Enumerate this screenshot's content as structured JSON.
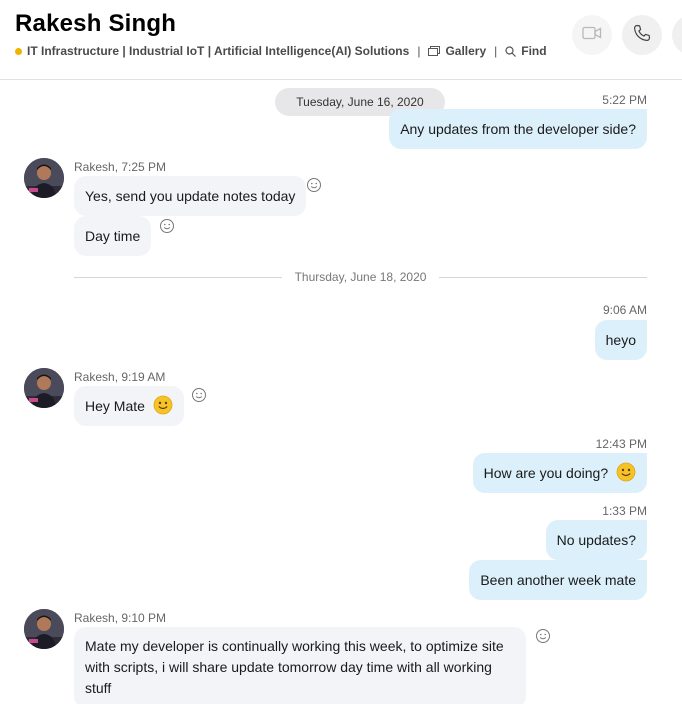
{
  "header": {
    "title": "Rakesh Singh",
    "status_color": "#f0b400",
    "mood": "IT Infrastructure | Industrial IoT | Artificial Intelligence(AI) Solutions",
    "separator": "|",
    "gallery_label": "Gallery",
    "find_label": "Find",
    "icons": [
      "video-call-icon",
      "phone-call-icon"
    ]
  },
  "accent_color": "#dcf0fb",
  "dates": {
    "d1": "Tuesday, June 16, 2020",
    "d2": "Thursday, June 18, 2020"
  },
  "messages": [
    {
      "dir": "out",
      "time": "5:22 PM",
      "text": "Any updates from the developer side?"
    },
    {
      "dir": "in",
      "meta": "Rakesh, 7:25 PM",
      "text": "Yes, send you update notes today"
    },
    {
      "dir": "in",
      "text": "Day time"
    },
    {
      "dir": "out",
      "time": "9:06 AM",
      "text": "heyo"
    },
    {
      "dir": "in",
      "meta": "Rakesh, 9:19 AM",
      "text": "Hey Mate",
      "emoji": "smile-emoji"
    },
    {
      "dir": "out",
      "time": "12:43 PM",
      "text": "How are you doing?",
      "emoji": "smile-emoji"
    },
    {
      "dir": "out",
      "time": "1:33 PM",
      "text": "No updates?"
    },
    {
      "dir": "out",
      "text": "Been another week mate"
    },
    {
      "dir": "in",
      "meta": "Rakesh, 9:10 PM",
      "text": "Mate my developer is continually working this week, to optimize site with scripts, i will share update tomorrow day time with all working stuff"
    }
  ]
}
